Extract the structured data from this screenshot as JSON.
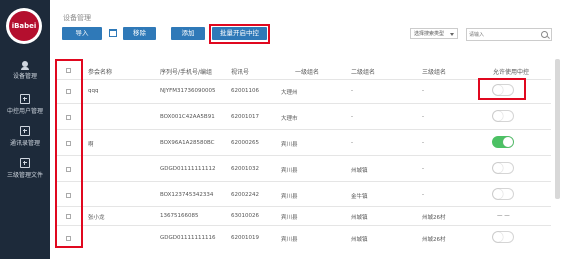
{
  "sidebar": {
    "logo_text": "iBabei",
    "items": [
      {
        "label": "设备管理",
        "icon": "device-icon"
      },
      {
        "label": "中控用户管理",
        "icon": "plus-square-icon"
      },
      {
        "label": "通讯录管理",
        "icon": "plus-square-icon"
      },
      {
        "label": "三级管理文件",
        "icon": "plus-square-icon"
      }
    ]
  },
  "header": {
    "title": "设备管理",
    "buttons": {
      "import": "导入",
      "remove": "移除",
      "add": "添加",
      "batch_enable": "批量开启中控"
    },
    "select_value": "选择搜索类型",
    "search_placeholder": "请输入"
  },
  "table": {
    "columns": [
      "参会名称",
      "序列号/手机号/编组",
      "视讯号",
      "一级组名",
      "二级组名",
      "三级组名",
      "允许使用中控"
    ],
    "rows": [
      {
        "name": "qqq",
        "serial": "NJYFM31736090005",
        "vid": "62001106",
        "l1": "大理州",
        "l2": "-",
        "l3": "-",
        "toggle": "off"
      },
      {
        "name": "",
        "serial": "BOX001C42AA5B91",
        "vid": "62001017",
        "l1": "大理市",
        "l2": "-",
        "l3": "-",
        "toggle": "off"
      },
      {
        "name": "啊",
        "serial": "BOX96A1A28580BC",
        "vid": "62000265",
        "l1": "宾川县",
        "l2": "-",
        "l3": "-",
        "toggle": "on"
      },
      {
        "name": "",
        "serial": "GDGD01111111112",
        "vid": "62001032",
        "l1": "宾川县",
        "l2": "州城镇",
        "l3": "-",
        "toggle": "off"
      },
      {
        "name": "",
        "serial": "BOX123745342334",
        "vid": "62002242",
        "l1": "宾川县",
        "l2": "金牛镇",
        "l3": "-",
        "toggle": "off"
      },
      {
        "name": "张小龙",
        "serial": "13675166085",
        "vid": "63010026",
        "l1": "宾川县",
        "l2": "州城镇",
        "l3": "州城26村",
        "toggle": "dash",
        "dash_text": "— —"
      },
      {
        "name": "",
        "serial": "GDGD01111111116",
        "vid": "62001019",
        "l1": "宾川县",
        "l2": "州城镇",
        "l3": "州城26村",
        "toggle": "off"
      }
    ]
  }
}
